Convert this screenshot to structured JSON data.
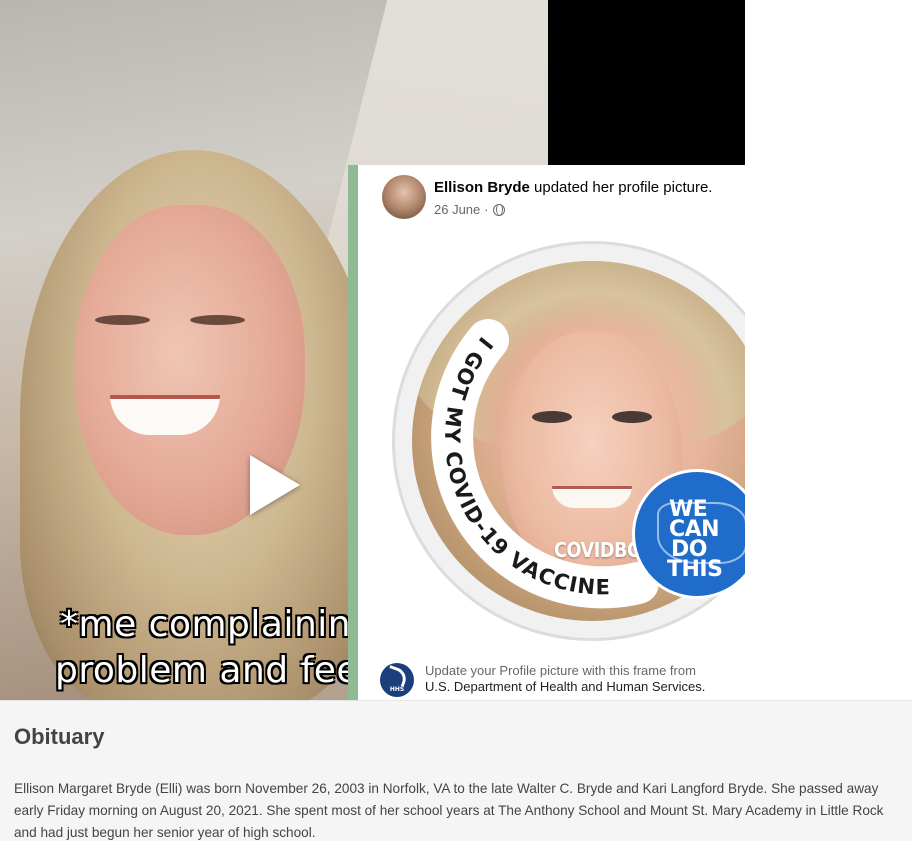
{
  "video": {
    "caption_line1": "*me complaining",
    "caption_line2": "problem and feeli"
  },
  "facebook_post": {
    "author": "Ellison Bryde",
    "action": " updated her profile picture.",
    "date": "26 June",
    "separator": "·",
    "frame": {
      "arc_text": "I GOT MY COVID-19 VACCINE",
      "url": "COVIDBC.ME",
      "badge_lines": [
        "WE",
        "CAN",
        "DO",
        "THIS"
      ],
      "badge_color": "#1f6ccb"
    },
    "footer_line1": "Update your Profile picture with this frame from",
    "footer_line2": "U.S. Department of Health and Human Services.",
    "footer_icon_label": "HHS"
  },
  "obituary": {
    "heading": "Obituary",
    "body": "Ellison Margaret Bryde  (Elli) was born November 26, 2003 in Norfolk, VA to the late Walter C. Bryde and Kari Langford Bryde.  She passed away early Friday morning on August 20, 2021. She spent most of her school years at The Anthony School and Mount St. Mary Academy in Little Rock and had just begun her senior year of high school."
  }
}
